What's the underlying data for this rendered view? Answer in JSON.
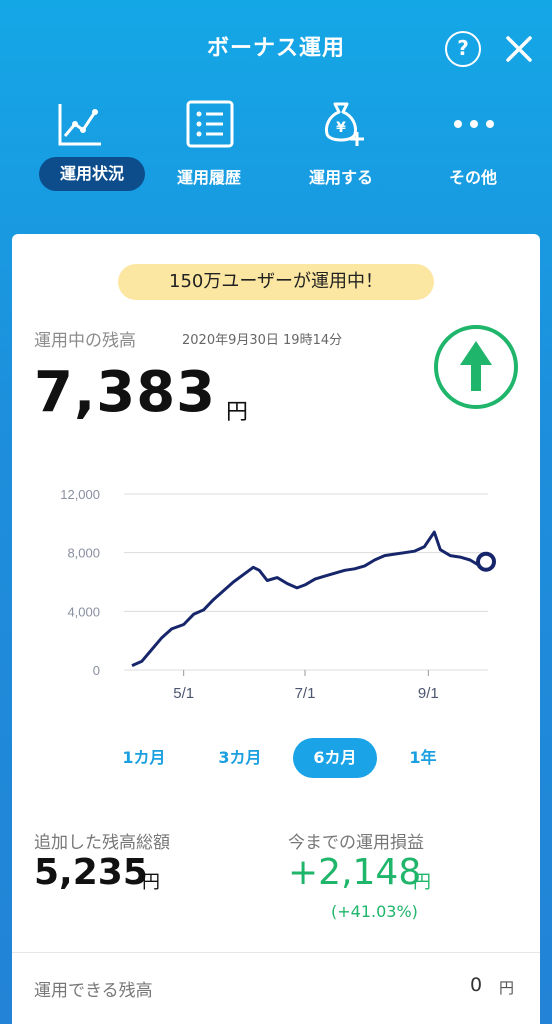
{
  "header": {
    "title": "ボーナス運用",
    "help_label": "?"
  },
  "nav": {
    "items": [
      {
        "label": "運用状況",
        "icon": "chart-line-icon",
        "active": true
      },
      {
        "label": "運用履歴",
        "icon": "list-icon",
        "active": false
      },
      {
        "label": "運用する",
        "icon": "money-bag-plus-icon",
        "active": false
      },
      {
        "label": "その他",
        "icon": "more-dots-icon",
        "active": false
      }
    ]
  },
  "banner": "150万ユーザーが運用中！",
  "balance": {
    "label": "運用中の残高",
    "timestamp": "2020年9月30日 19時14分",
    "value": "7,383",
    "unit": "円",
    "trend_icon": "arrow-up-icon"
  },
  "colors": {
    "accent": "#1aa3e6",
    "navy": "#0d4d8c",
    "gain": "#1fb56a",
    "line": "#17266b"
  },
  "chart_data": {
    "type": "line",
    "ylim": [
      0,
      12000
    ],
    "y_ticks": [
      "0",
      "4,000",
      "8,000",
      "12,000"
    ],
    "x_ticks": [
      "5/1",
      "7/1",
      "9/1"
    ],
    "grid": true,
    "series": [
      {
        "x": [
          "2020-04-05",
          "2020-04-10",
          "2020-04-15",
          "2020-04-20",
          "2020-04-25",
          "2020-05-01",
          "2020-05-06",
          "2020-05-11",
          "2020-05-16",
          "2020-05-21",
          "2020-05-26",
          "2020-05-31",
          "2020-06-05",
          "2020-06-08",
          "2020-06-12",
          "2020-06-17",
          "2020-06-22",
          "2020-06-27",
          "2020-07-01",
          "2020-07-06",
          "2020-07-11",
          "2020-07-16",
          "2020-07-21",
          "2020-07-26",
          "2020-07-31",
          "2020-08-05",
          "2020-08-10",
          "2020-08-15",
          "2020-08-20",
          "2020-08-25",
          "2020-08-30",
          "2020-09-01",
          "2020-09-04",
          "2020-09-07",
          "2020-09-12",
          "2020-09-17",
          "2020-09-22",
          "2020-09-27",
          "2020-09-30"
        ],
        "y": [
          300,
          600,
          1400,
          2200,
          2800,
          3100,
          3800,
          4100,
          4800,
          5400,
          6000,
          6500,
          7000,
          6800,
          6100,
          6300,
          5900,
          5600,
          5800,
          6200,
          6400,
          6600,
          6800,
          6900,
          7100,
          7500,
          7800,
          7900,
          8000,
          8100,
          8400,
          8800,
          9400,
          8200,
          7800,
          7700,
          7500,
          7100,
          7383
        ]
      }
    ],
    "end_marker": true
  },
  "ranges": {
    "items": [
      {
        "label": "1カ月",
        "active": false
      },
      {
        "label": "3カ月",
        "active": false
      },
      {
        "label": "6カ月",
        "active": true
      },
      {
        "label": "1年",
        "active": false
      }
    ]
  },
  "stats": {
    "added": {
      "label": "追加した残高総額",
      "value": "5,235",
      "unit": "円"
    },
    "profit": {
      "label": "今までの運用損益",
      "value": "+2,148",
      "unit": "円",
      "percent": "(+41.03%)"
    }
  },
  "available": {
    "label": "運用できる残高",
    "value": "0",
    "unit": "円"
  }
}
